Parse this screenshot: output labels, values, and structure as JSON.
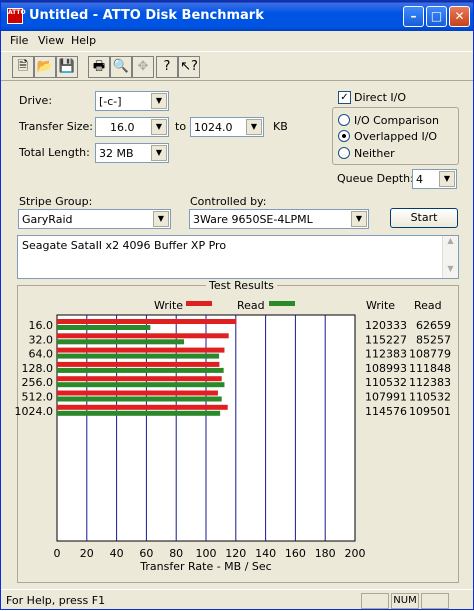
{
  "window": {
    "title": "Untitled - ATTO Disk Benchmark",
    "app_icon": "ATTO"
  },
  "menu": {
    "items": [
      "File",
      "View",
      "Help"
    ]
  },
  "form": {
    "drive_label": "Drive:",
    "drive_value": "[-c-]",
    "transfer_size_label": "Transfer Size:",
    "transfer_from": "16.0",
    "to_label": "to",
    "transfer_to": "1024.0",
    "kb_label": "KB",
    "total_length_label": "Total Length:",
    "total_length_value": "32 MB",
    "direct_io_label": "Direct I/O",
    "direct_io_checked": true,
    "io_comparison_label": "I/O Comparison",
    "overlapped_io_label": "Overlapped I/O",
    "neither_label": "Neither",
    "selected_mode": "Overlapped I/O",
    "queue_depth_label": "Queue Depth:",
    "queue_depth_value": "4",
    "stripe_group_label": "Stripe Group:",
    "stripe_group_value": "GaryRaid",
    "controlled_by_label": "Controlled by:",
    "controlled_by_value": "3Ware 9650SE-4LPML",
    "start_label": "Start",
    "description": "Seagate SataII x2  4096 Buffer XP Pro"
  },
  "results": {
    "title": "Test Results",
    "legend_write": "Write",
    "legend_read": "Read",
    "col_write": "Write",
    "col_read": "Read",
    "write_color": "#e02020",
    "read_color": "#2a8a2a",
    "grid_color": "#1a1a8c"
  },
  "chart_data": {
    "type": "bar",
    "title": "Test Results",
    "categories": [
      "16.0",
      "32.0",
      "64.0",
      "128.0",
      "256.0",
      "512.0",
      "1024.0"
    ],
    "series": [
      {
        "name": "Write",
        "values": [
          120333,
          115227,
          112383,
          108993,
          110532,
          107991,
          114576
        ]
      },
      {
        "name": "Read",
        "values": [
          62659,
          85257,
          108779,
          111848,
          112383,
          110532,
          109501
        ]
      }
    ],
    "xlabel": "Transfer Rate - MB / Sec",
    "xlim": [
      0,
      200
    ],
    "xticks": [
      "0",
      "20",
      "40",
      "60",
      "80",
      "100",
      "120",
      "140",
      "160",
      "180",
      "200"
    ],
    "legend": "top"
  },
  "status": {
    "text": "For Help, press F1",
    "num": "NUM"
  }
}
